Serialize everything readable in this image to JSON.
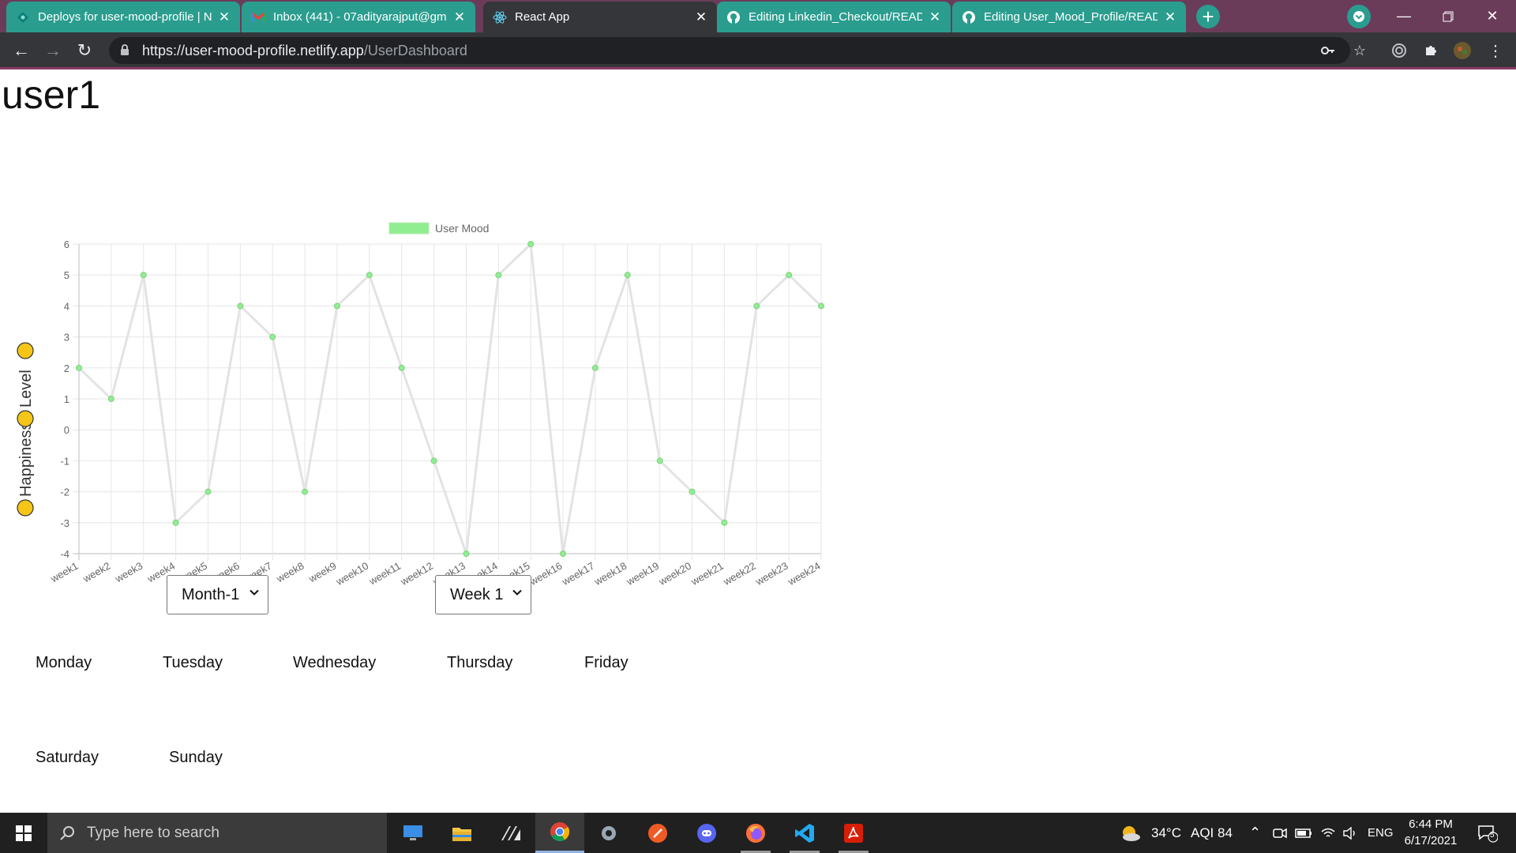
{
  "browser": {
    "tabs": [
      {
        "title": "Deploys for user-mood-profile | N",
        "icon": "netlify-icon"
      },
      {
        "title": "Inbox (441) - 07adityarajput@gm",
        "icon": "gmail-icon"
      },
      {
        "title": "React App",
        "icon": "react-icon"
      },
      {
        "title": "Editing Linkedin_Checkout/READ",
        "icon": "github-icon"
      },
      {
        "title": "Editing User_Mood_Profile/READ",
        "icon": "github-icon"
      }
    ],
    "url_main": "https://user-mood-profile.netlify.app",
    "url_path": "/UserDashboard",
    "colors": {
      "tabstrip": "#6b3c5a",
      "teal_tab": "#2a9d8f",
      "toolbar": "#35363a"
    }
  },
  "page": {
    "username": "user1",
    "month_select": "Month-1",
    "week_select": "Week 1",
    "days": [
      "Monday",
      "Tuesday",
      "Wednesday",
      "Thursday",
      "Friday",
      "Saturday",
      "Sunday"
    ]
  },
  "chart_data": {
    "type": "line",
    "title": "",
    "legend": "User Mood",
    "legend_color": "#90ee90",
    "line_color": "#e3e3e3",
    "point_color": "#90ee90",
    "ylabel_parts": [
      "Happiness",
      "Level"
    ],
    "ylim": [
      -4,
      6
    ],
    "yticks": [
      6,
      5,
      4,
      3,
      2,
      1,
      0,
      -1,
      -2,
      -3,
      -4
    ],
    "grid": true,
    "categories": [
      "week1",
      "week2",
      "week3",
      "week4",
      "week5",
      "week6",
      "week7",
      "week8",
      "week9",
      "week10",
      "week11",
      "week12",
      "week13",
      "week14",
      "week15",
      "week16",
      "week17",
      "week18",
      "week19",
      "week20",
      "week21",
      "week22",
      "week23",
      "week24"
    ],
    "series": [
      {
        "name": "User Mood",
        "values": [
          2,
          1,
          5,
          -3,
          -2,
          4,
          3,
          -2,
          4,
          5,
          2,
          -1,
          -4,
          5,
          6,
          -4,
          2,
          5,
          -1,
          -2,
          -3,
          4,
          5,
          4
        ]
      }
    ]
  },
  "taskbar": {
    "search_placeholder": "Type here to search",
    "apps": [
      "desktop-icon",
      "file-explorer-icon",
      "clip-studio-icon",
      "chrome-icon",
      "settings-icon",
      "postman-icon",
      "discord-icon",
      "firefox-icon",
      "vscode-icon",
      "acrobat-icon"
    ],
    "weather": "34°C",
    "aqi": "AQI 84",
    "language": "ENG",
    "time": "6:44 PM",
    "date": "6/17/2021",
    "notification_count": "5"
  }
}
